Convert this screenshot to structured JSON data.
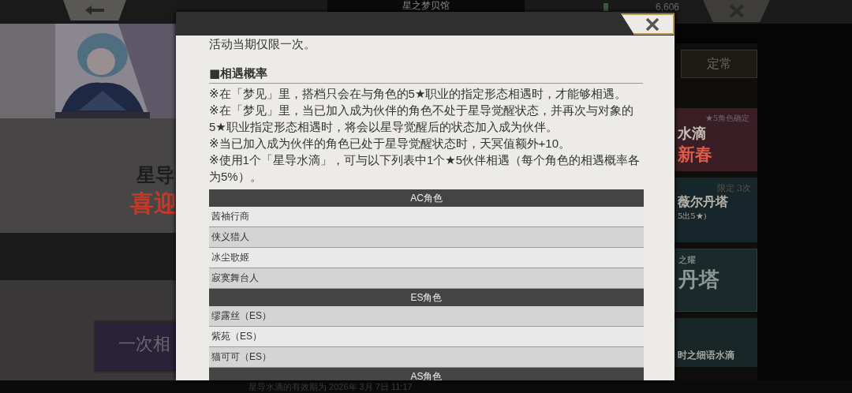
{
  "top_bar": {
    "title": "星之梦贝馆",
    "currency": "6,606"
  },
  "banner": {
    "title_line1": "星导",
    "title_line2": "喜迎"
  },
  "draw_button": {
    "label": "一次相"
  },
  "side_tab": {
    "label": "定常"
  },
  "side_cards": [
    {
      "kind": "featured",
      "lines": [
        "★5角色确定",
        "水滴",
        "新春"
      ]
    },
    {
      "kind": "limited",
      "lines": [
        "限定 3次",
        "薇尔丹塔",
        "5出5★)"
      ]
    },
    {
      "kind": "plain",
      "lines": [
        "之耀",
        "丹塔"
      ]
    },
    {
      "kind": "small",
      "lines": [
        "时之细语水滴"
      ]
    }
  ],
  "footer": "星导水滴的有效期为 2026年 3月 7日 11:17",
  "dialog": {
    "intro": "活动当期仅限一次。",
    "section_title": "■相遇概率",
    "notes": [
      "※在「梦见」里，搭档只会在与角色的5★职业的指定形态相遇时，才能够相遇。",
      "※在「梦见」里，当已加入成为伙伴的角色不处于星导觉醒状态，并再次与对象的5★职业指定形态相遇时，将会以星导觉醒后的状态加入成为伙伴。",
      "※当已加入成为伙伴的角色已处于星导觉醒状态时，天冥值额外+10。",
      "※使用1个「星导水滴」，可与以下列表中1个★5伙伴相遇（每个角色的相遇概率各为5%）。"
    ],
    "table": [
      {
        "header": "AC角色",
        "rows": [
          {
            "name": "茜袖行商",
            "shaded": false
          },
          {
            "name": "侠义猎人",
            "shaded": true
          },
          {
            "name": "冰尘歌姬",
            "shaded": false
          },
          {
            "name": "寂寞舞台人",
            "shaded": true
          }
        ]
      },
      {
        "header": "ES角色",
        "rows": [
          {
            "name": "缪露丝（ES）",
            "shaded": true
          },
          {
            "name": "紫苑（ES）",
            "shaded": false
          },
          {
            "name": "猫可可（ES）",
            "shaded": true
          }
        ]
      },
      {
        "header": "AS角色"
      }
    ]
  }
}
